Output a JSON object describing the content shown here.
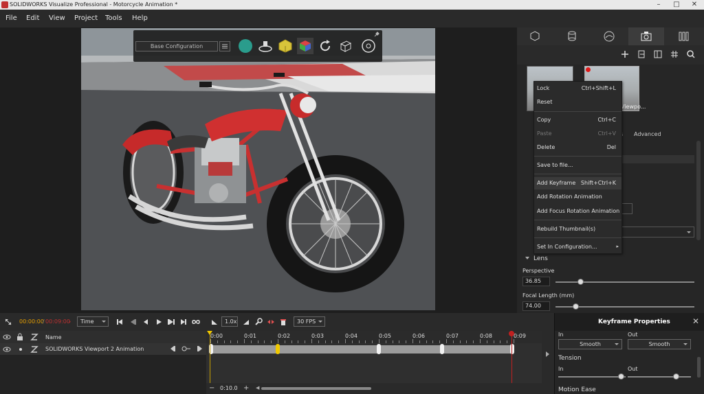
{
  "window": {
    "title": "SOLIDWORKS Visualize Professional - Motorcycle Animation *"
  },
  "menu": [
    "File",
    "Edit",
    "View",
    "Project",
    "Tools",
    "Help"
  ],
  "viewport_toolbar": {
    "configuration": "Base Configuration"
  },
  "thumbnails": [
    {
      "label": ""
    },
    {
      "label": "Viewpo..."
    }
  ],
  "sub_tabs": {
    "partial": "s",
    "advanced": "Advanced"
  },
  "context_menu": [
    {
      "label": "Lock",
      "shortcut": "Ctrl+Shift+L",
      "disabled": false
    },
    {
      "label": "Reset",
      "shortcut": "",
      "disabled": false
    },
    {
      "label": "Copy",
      "shortcut": "Ctrl+C",
      "disabled": false
    },
    {
      "label": "Paste",
      "shortcut": "Ctrl+V",
      "disabled": true
    },
    {
      "label": "Delete",
      "shortcut": "Del",
      "disabled": false
    },
    {
      "label": "Save to file...",
      "shortcut": "",
      "disabled": false
    },
    {
      "label": "Add Keyframe",
      "shortcut": "Shift+Ctrl+K",
      "disabled": false
    },
    {
      "label": "Add Rotation Animation",
      "shortcut": "",
      "disabled": false
    },
    {
      "label": "Add Focus Rotation Animation",
      "shortcut": "",
      "disabled": false
    },
    {
      "label": "Rebuild Thumbnail(s)",
      "shortcut": "",
      "disabled": false
    },
    {
      "label": "Set In Configuration...",
      "shortcut": "",
      "disabled": false
    }
  ],
  "lens": {
    "title": "Lens",
    "perspective_label": "Perspective",
    "perspective_value": "36.85",
    "focal_label": "Focal Length (mm)",
    "focal_value": "74.00"
  },
  "transport": {
    "current_time": "00:00:00",
    "end_time": "00:09:00",
    "mode": "Time",
    "speed": "1.0x",
    "fps": "30 FPS"
  },
  "tracks": {
    "name_header": "Name",
    "row_name": "SOLIDWORKS Viewport 2 Animation"
  },
  "ruler": [
    "0:00",
    "0:01",
    "0:02",
    "0:03",
    "0:04",
    "0:05",
    "0:06",
    "0:07",
    "0:08",
    "0:09"
  ],
  "timeline_footer": {
    "zoom": "0:10.0"
  },
  "keyframe_properties": {
    "title": "Keyframe Properties",
    "ease_in_label": "In",
    "ease_out_label": "Out",
    "ease_in_value": "Smooth",
    "ease_out_value": "Smooth",
    "tension_label": "Tension",
    "tension_in_label": "In",
    "tension_out_label": "Out",
    "motion_ease_label": "Motion Ease"
  },
  "colors": {
    "accent_yellow": "#f0c800",
    "end_red": "#c02020",
    "time_orange": "#e8a000"
  }
}
